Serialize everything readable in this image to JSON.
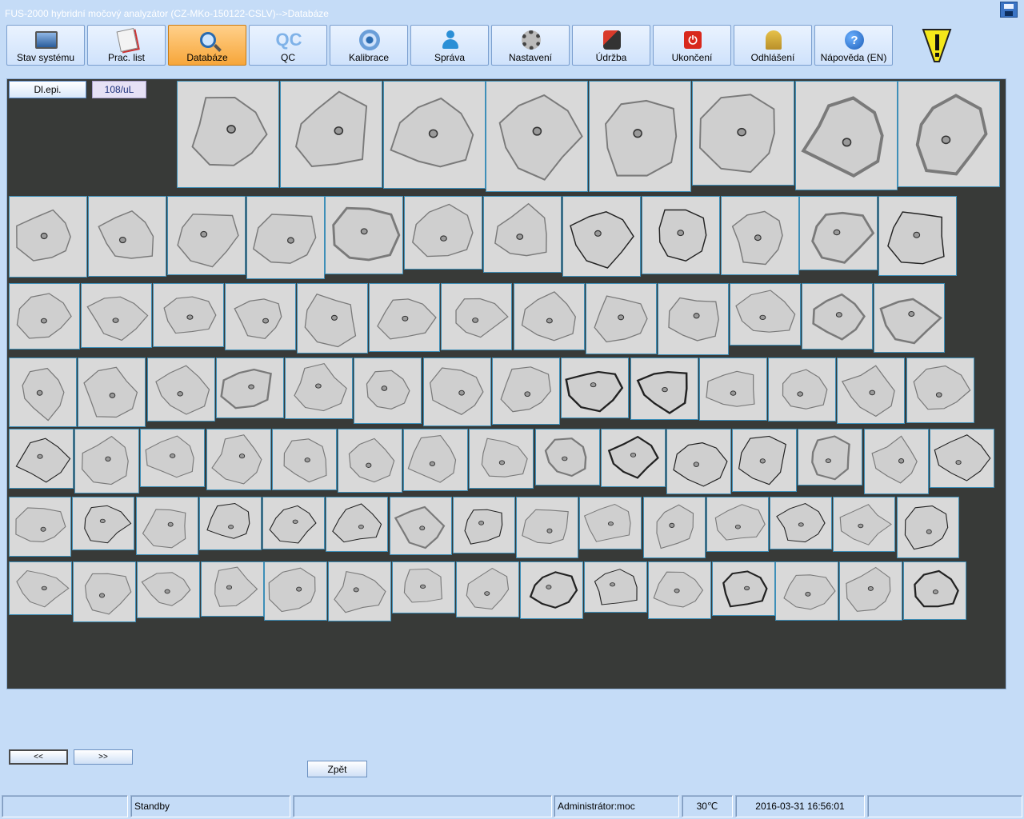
{
  "window": {
    "title": "FUS-2000 hybridní močový analyzátor (CZ-MKo-150122-CSLV)-->Databáze"
  },
  "toolbar": {
    "buttons": [
      {
        "label": "Stav systému",
        "icon": "monitor-icon"
      },
      {
        "label": "Prac. list",
        "icon": "worklist-icon"
      },
      {
        "label": "Databáze",
        "icon": "magnifier-icon",
        "active": true
      },
      {
        "label": "QC",
        "icon": "qc-icon",
        "icon_text": "QC"
      },
      {
        "label": "Kalibrace",
        "icon": "calibration-target-icon"
      },
      {
        "label": "Správa",
        "icon": "person-icon"
      },
      {
        "label": "Nastavení",
        "icon": "gear-icon"
      },
      {
        "label": "Údržba",
        "icon": "maintenance-icon"
      },
      {
        "label": "Ukončení",
        "icon": "power-icon"
      },
      {
        "label": "Odhlášení",
        "icon": "keys-icon"
      },
      {
        "label": "Nápověda (EN)",
        "icon": "help-icon",
        "icon_text": "?"
      }
    ]
  },
  "gallery": {
    "category": "Dl.epi.",
    "concentration": "108/uL",
    "rows": [
      {
        "count": 8
      },
      {
        "count": 12
      },
      {
        "count": 13
      },
      {
        "count": 14
      },
      {
        "count": 15
      },
      {
        "count": 15
      },
      {
        "count": 15
      }
    ]
  },
  "navigation": {
    "prev_label": "<<",
    "next_label": ">>",
    "back_label": "Zpět"
  },
  "status": {
    "cell1": "",
    "state": "Standby",
    "cell3": "",
    "user": "Administrátor:moc",
    "temperature": "30℃",
    "datetime": "2016-03-31 16:56:01"
  },
  "colors": {
    "background": "#c5dcf7",
    "panel": "#383a38",
    "active_button": "#f7a63a",
    "cell_border": "#3e8fb8"
  }
}
